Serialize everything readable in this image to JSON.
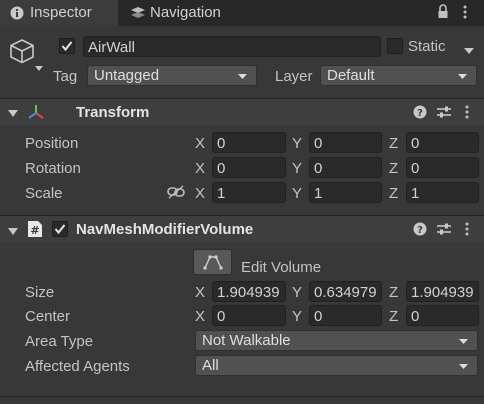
{
  "tabs": [
    {
      "label": "Inspector",
      "icon": "info-icon"
    },
    {
      "label": "Navigation",
      "icon": "navigation-icon"
    }
  ],
  "object": {
    "name": "AirWall",
    "active": true,
    "static_label": "Static",
    "static": false,
    "tag_label": "Tag",
    "tag_value": "Untagged",
    "layer_label": "Layer",
    "layer_value": "Default"
  },
  "transform": {
    "title": "Transform",
    "rows": [
      {
        "label": "Position",
        "x": "0",
        "y": "0",
        "z": "0"
      },
      {
        "label": "Rotation",
        "x": "0",
        "y": "0",
        "z": "0"
      },
      {
        "label": "Scale",
        "x": "1",
        "y": "1",
        "z": "1"
      }
    ]
  },
  "navmesh": {
    "title": "NavMeshModifierVolume",
    "enabled": true,
    "edit_label": "Edit Volume",
    "size": {
      "label": "Size",
      "x": "1.904939",
      "y": "0.634979",
      "z": "1.904939"
    },
    "center": {
      "label": "Center",
      "x": "0",
      "y": "0",
      "z": "0"
    },
    "area_type": {
      "label": "Area Type",
      "value": "Not Walkable"
    },
    "affected_agents": {
      "label": "Affected Agents",
      "value": "All"
    }
  },
  "axes": {
    "x": "X",
    "y": "Y",
    "z": "Z"
  },
  "colors": {
    "background": "#383838",
    "tab_bar": "#282828",
    "field": "#2a2a2a",
    "text": "#c4c4c4"
  }
}
